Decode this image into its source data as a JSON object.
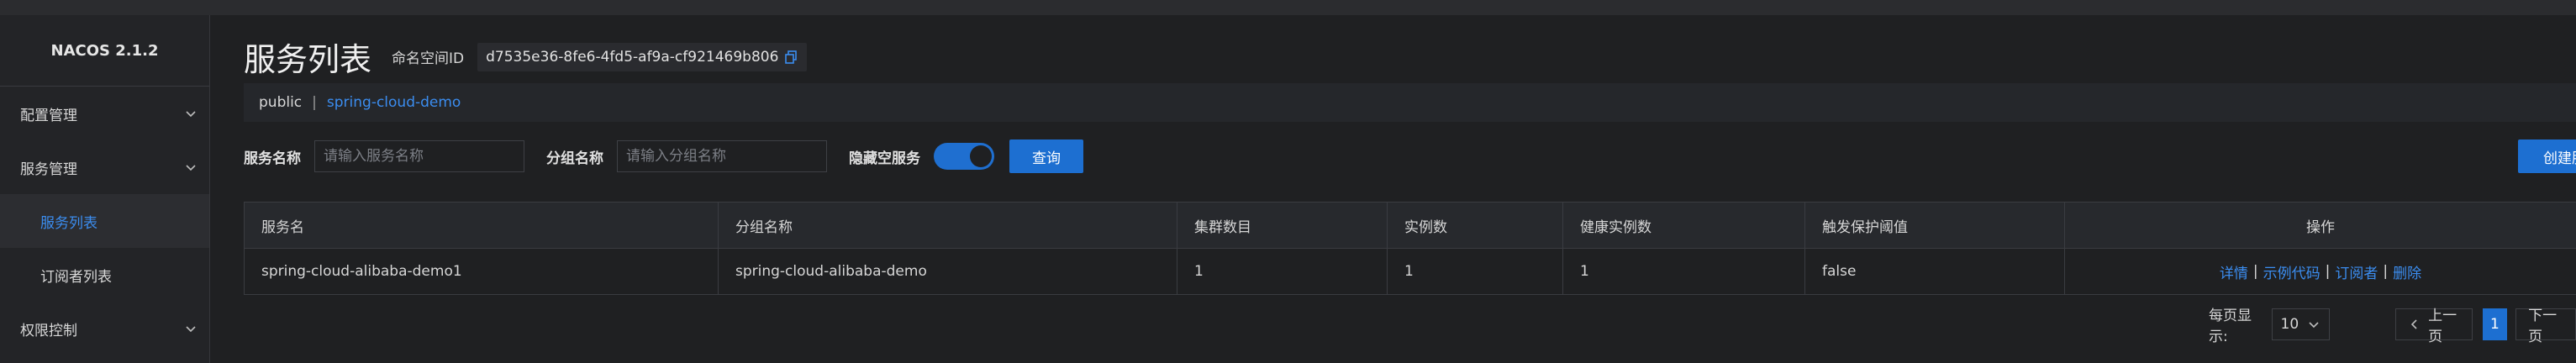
{
  "app": {
    "brand": "NACOS 2.1.2"
  },
  "sidebar": {
    "items": [
      {
        "label": "配置管理"
      },
      {
        "label": "服务管理"
      },
      {
        "label": "服务列表"
      },
      {
        "label": "订阅者列表"
      },
      {
        "label": "权限控制"
      }
    ]
  },
  "header": {
    "title": "服务列表",
    "namespace_label": "命名空间ID",
    "namespace_id": "d7535e36-8fe6-4fd5-af9a-cf921469b806"
  },
  "namespace_bar": {
    "public": "public",
    "separator": "|",
    "current": "spring-cloud-demo"
  },
  "filters": {
    "service_label": "服务名称",
    "service_placeholder": "请输入服务名称",
    "group_label": "分组名称",
    "group_placeholder": "请输入分组名称",
    "hide_empty_label": "隐藏空服务",
    "hide_empty_on": true,
    "query_label": "查询",
    "create_label": "创建服务"
  },
  "table": {
    "columns": [
      "服务名",
      "分组名称",
      "集群数目",
      "实例数",
      "健康实例数",
      "触发保护阈值",
      "操作"
    ],
    "rows": [
      {
        "service": "spring-cloud-alibaba-demo1",
        "group": "spring-cloud-alibaba-demo",
        "clusters": "1",
        "instances": "1",
        "healthy": "1",
        "protect": "false",
        "ops": {
          "detail": "详情",
          "sample": "示例代码",
          "subscriber": "订阅者",
          "delete": "删除",
          "sep": "|"
        }
      }
    ]
  },
  "pagination": {
    "page_size_label": "每页显示:",
    "page_size": "10",
    "prev": "上一页",
    "current": "1",
    "next": "下一页"
  },
  "colors": {
    "accent": "#1d6fd1",
    "link": "#3b8df0",
    "bg": "#1f2022"
  }
}
